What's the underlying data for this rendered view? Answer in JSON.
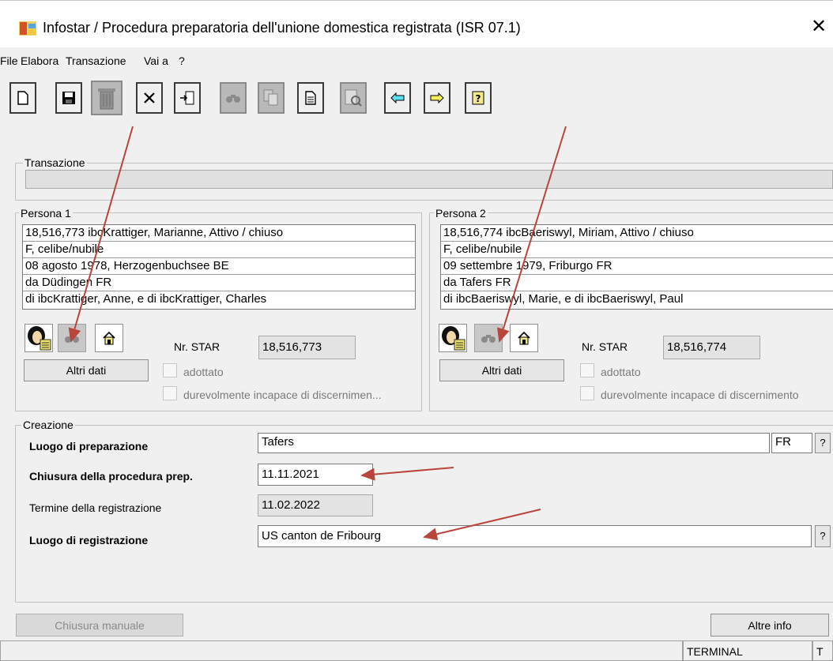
{
  "window": {
    "title": "Infostar / Procedura preparatoria dell'unione domestica registrata (ISR 07.1)",
    "close_glyph": "✕"
  },
  "menu": {
    "file": "File",
    "elabora": "Elabora",
    "transazione": "Transazione",
    "vai_a": "Vai a",
    "help": "?"
  },
  "toolbar": {
    "icons": [
      "new-document-icon",
      "save-icon",
      "trash-icon",
      "delete-x-icon",
      "import-icon",
      "search-binoculars-icon",
      "copy-documents-icon",
      "document-icon",
      "print-preview-icon",
      "arrow-left-icon",
      "arrow-right-icon",
      "help-icon"
    ]
  },
  "transazione": {
    "title": "Transazione",
    "value": ""
  },
  "persona1": {
    "title": "Persona 1",
    "lines": [
      "18,516,773  ibcKrattiger, Marianne, Attivo / chiuso",
      "F, celibe/nubile",
      "08 agosto 1978, Herzogenbuchsee BE",
      "da Düdingen FR",
      "di ibcKrattiger, Anne, e di ibcKrattiger, Charles"
    ],
    "nr_star_label": "Nr. STAR",
    "nr_star_value": "18,516,773",
    "altri_dati": "Altri dati",
    "adottato": "adottato",
    "incapace": "durevolmente incapace di discernimen..."
  },
  "persona2": {
    "title": "Persona 2",
    "lines": [
      "18,516,774  ibcBaeriswyl, Miriam, Attivo / chiuso",
      "F, celibe/nubile",
      "09 settembre 1979, Friburgo FR",
      "da Tafers FR",
      "di ibcBaeriswyl, Marie, e di ibcBaeriswyl, Paul"
    ],
    "nr_star_label": "Nr. STAR",
    "nr_star_value": "18,516,774",
    "altri_dati": "Altri dati",
    "adottato": "adottato",
    "incapace": "durevolmente incapace di discernimento"
  },
  "creazione": {
    "title": "Creazione",
    "luogo_prep_label": "Luogo di preparazione",
    "luogo_prep_value": "Tafers",
    "canton": "FR",
    "help": "?",
    "chiusura_label": "Chiusura della procedura prep.",
    "chiusura_value": "11.11.2021",
    "termine_label": "Termine della registrazione",
    "termine_value": "11.02.2022",
    "luogo_reg_label": "Luogo di registrazione",
    "luogo_reg_value": "US canton de Fribourg"
  },
  "buttons": {
    "chiusura_manuale": "Chiusura manuale",
    "altre_info": "Altre info"
  },
  "status": {
    "terminal": "TERMINAL",
    "t": "T"
  },
  "colors": {
    "annotation_arrow": "#b8463c"
  }
}
